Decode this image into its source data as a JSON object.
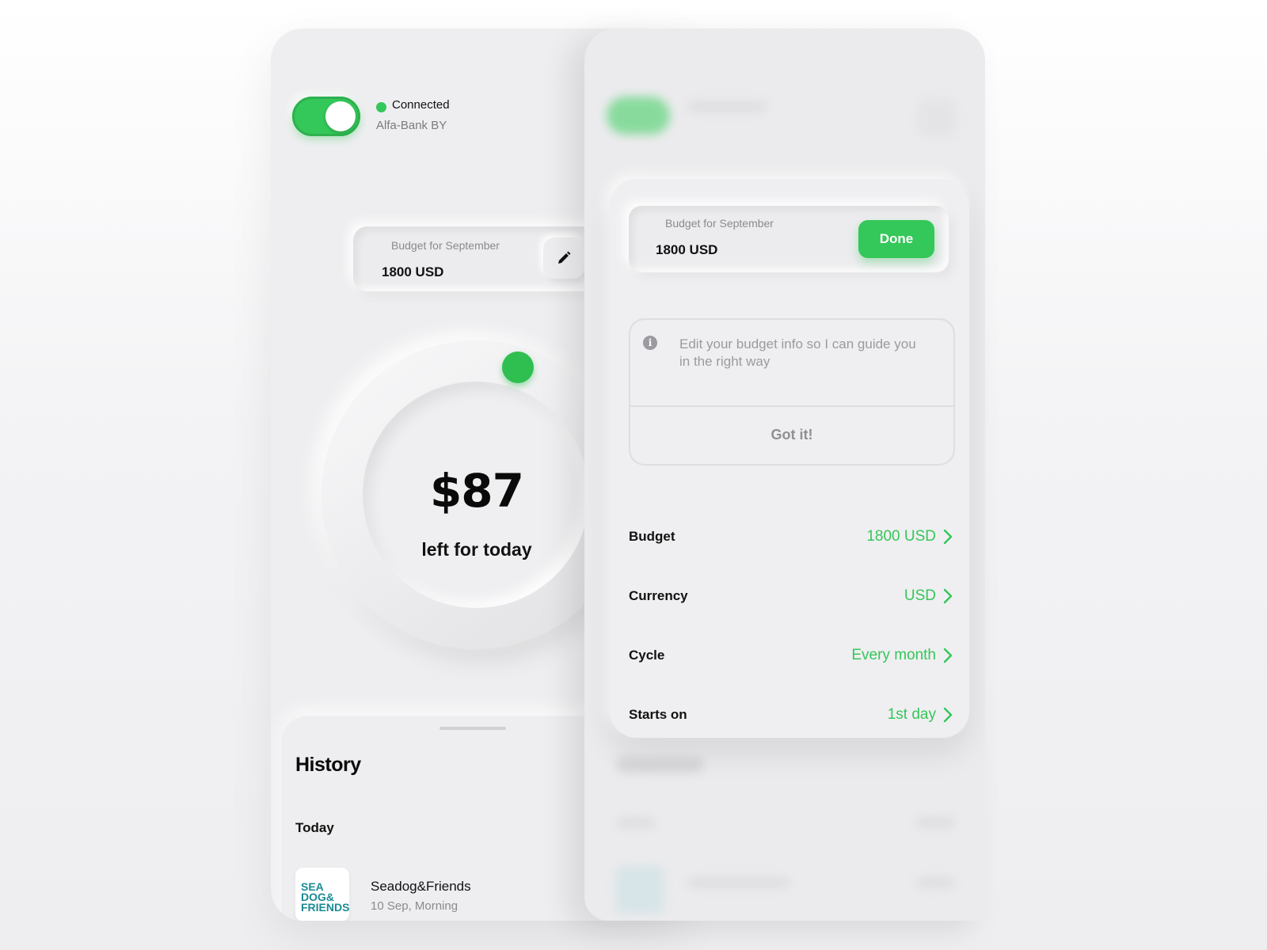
{
  "connection": {
    "status": "Connected",
    "bank": "Alfa-Bank BY",
    "toggle_on": true,
    "accent_color": "#34c759"
  },
  "budget_card": {
    "label": "Budget for September",
    "value": "1800 USD",
    "edit_icon": "pencil-icon"
  },
  "today_remaining": {
    "amount": "$87",
    "caption": "left for today"
  },
  "history": {
    "title": "History",
    "group_label": "Today",
    "items": [
      {
        "logo_text": "SEA DOG& FRIENDS",
        "merchant": "Seadog&Friends",
        "time": "10 Sep, Morning"
      }
    ]
  },
  "edit_panel": {
    "input_label": "Budget for September",
    "input_value": "1800 USD",
    "done_label": "Done",
    "info_icon": "info-icon",
    "info_text": "Edit your budget info so I can guide you in the right way",
    "got_it_label": "Got it!",
    "settings": [
      {
        "label": "Budget",
        "value": "1800 USD"
      },
      {
        "label": "Currency",
        "value": "USD"
      },
      {
        "label": "Cycle",
        "value": "Every month"
      },
      {
        "label": "Starts on",
        "value": "1st day"
      }
    ],
    "chevron_icon": "chevron-right-icon"
  }
}
